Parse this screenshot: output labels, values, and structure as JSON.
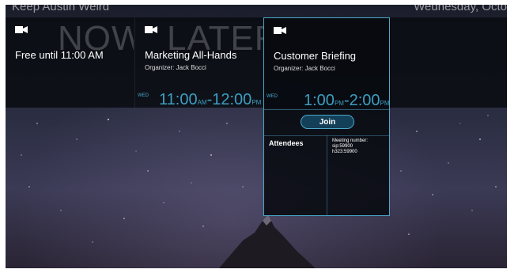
{
  "header": {
    "left_title": "Keep Austin Weird",
    "right_date": "Wednesday, Octo"
  },
  "panels": {
    "now": {
      "big_word": "NOW",
      "title": "Free until 11:00 AM"
    },
    "later": {
      "big_word": "LATER",
      "title": "Marketing All-Hands",
      "organizer": "Organizer: Jack Bocci",
      "day": "WED",
      "start": "11:00",
      "start_ampm": "AM",
      "sep": "-",
      "end": "12:00",
      "end_ampm": "PM"
    },
    "selected": {
      "title": "Customer Briefing",
      "organizer": "Organizer: Jack Bocci",
      "day": "WED",
      "start": "1:00",
      "start_ampm": "PM",
      "sep": "-",
      "end": "2:00",
      "end_ampm": "PM",
      "join_label": "Join",
      "attendees_label": "Attendees",
      "meeting_lines": [
        "Meeting number:",
        "sip:59900",
        "h323:59900"
      ]
    }
  },
  "icons": {
    "camera": "video-camera-icon"
  },
  "colors": {
    "accent": "#4aa7c9",
    "time": "#3d9ec2",
    "join_bg": "#134058"
  }
}
